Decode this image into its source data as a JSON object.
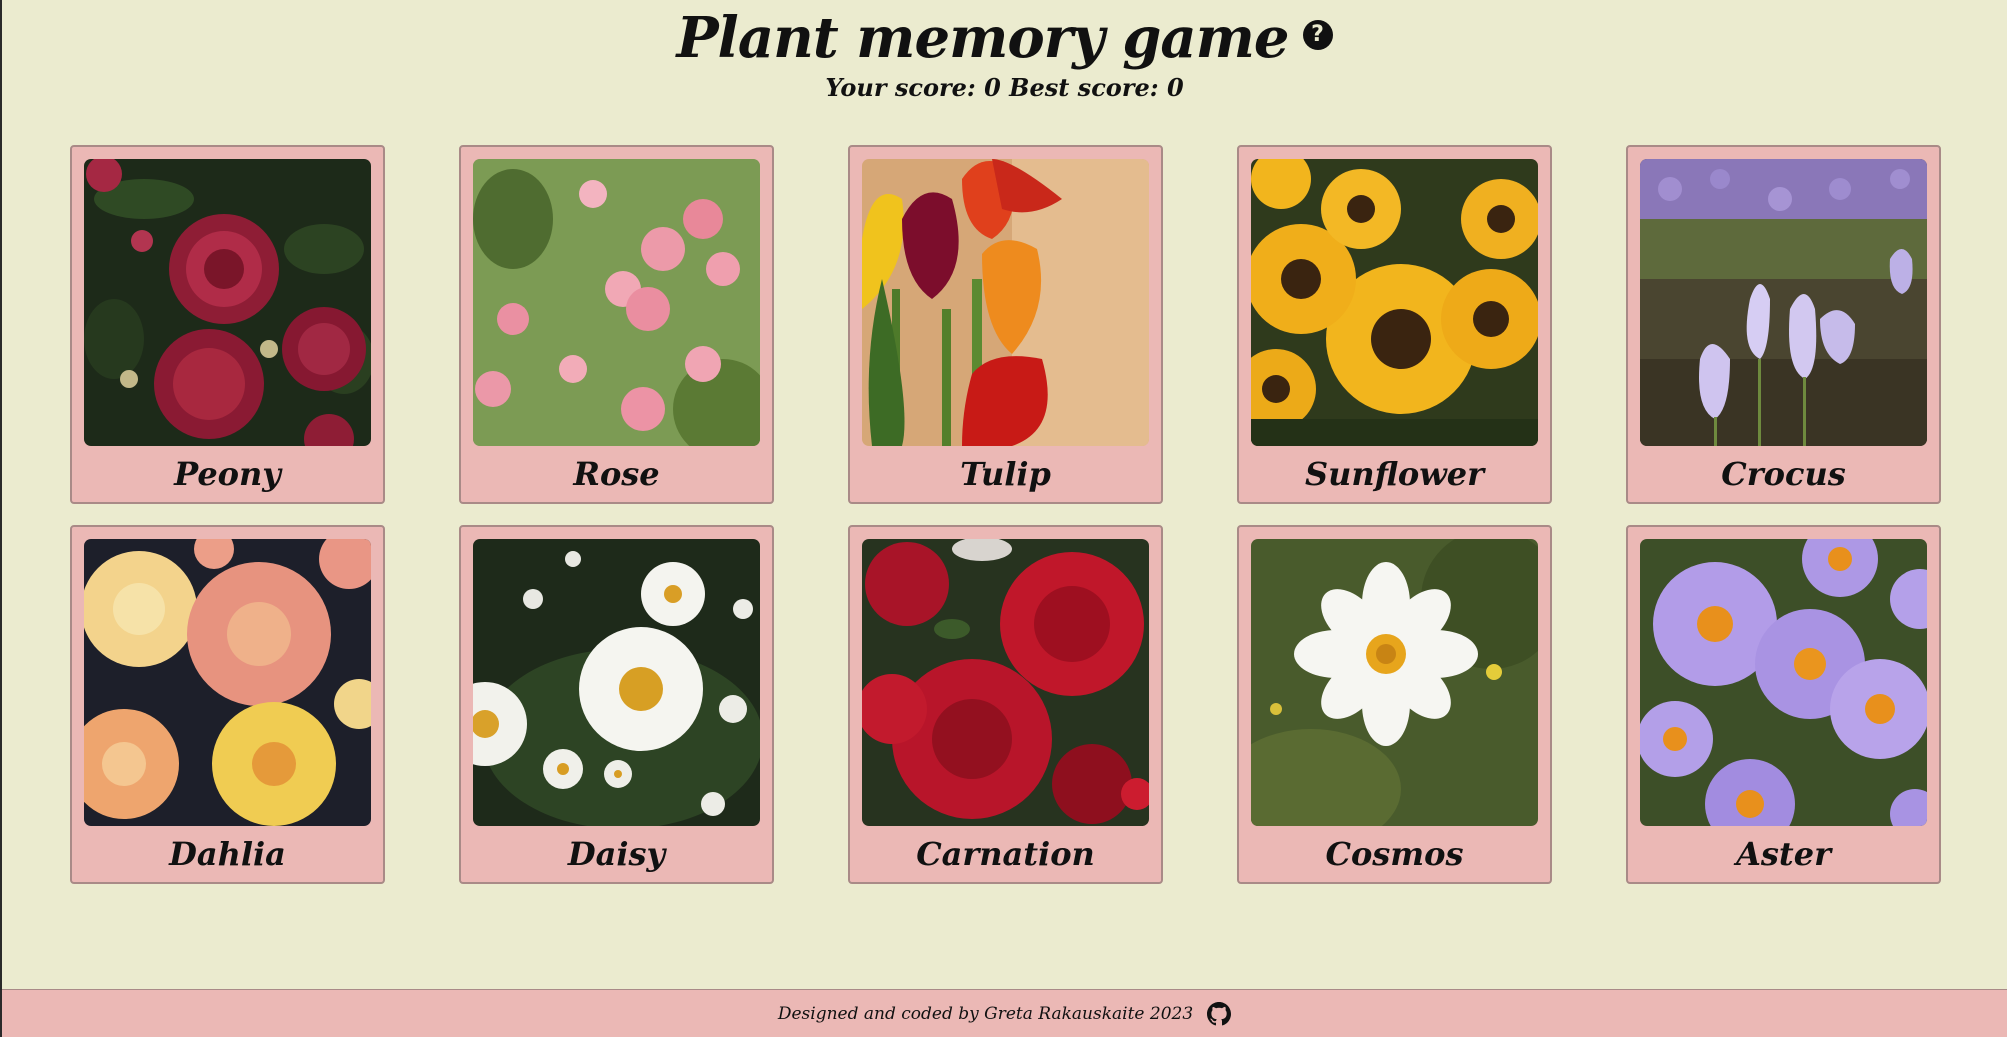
{
  "header": {
    "title": "Plant memory game",
    "help_icon": "question-circle-icon",
    "score_label": "Your score:",
    "score": "0",
    "best_label": "Best score:",
    "best": "0"
  },
  "cards": [
    {
      "label": "Peony",
      "image": "peony-photo"
    },
    {
      "label": "Rose",
      "image": "rose-photo"
    },
    {
      "label": "Tulip",
      "image": "tulip-photo"
    },
    {
      "label": "Sunflower",
      "image": "sunflower-photo"
    },
    {
      "label": "Crocus",
      "image": "crocus-photo"
    },
    {
      "label": "Dahlia",
      "image": "dahlia-photo"
    },
    {
      "label": "Daisy",
      "image": "daisy-photo"
    },
    {
      "label": "Carnation",
      "image": "carnation-photo"
    },
    {
      "label": "Cosmos",
      "image": "cosmos-photo"
    },
    {
      "label": "Aster",
      "image": "aster-photo"
    }
  ],
  "footer": {
    "credit": "Designed and coded by Greta Rakauskaite 2023",
    "github_icon": "github-icon"
  },
  "colors": {
    "background": "#ebebcf",
    "card": "#ebb8b5",
    "footer": "#ebb8b5",
    "text": "#111111"
  }
}
